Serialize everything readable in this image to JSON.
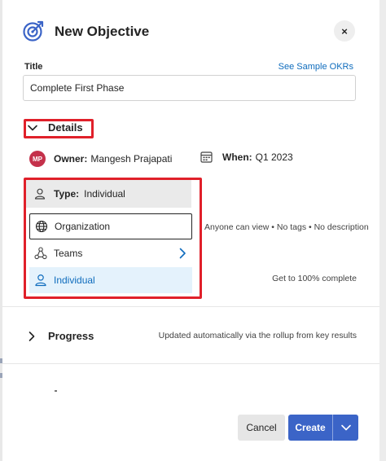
{
  "dialog": {
    "title": "New Objective",
    "close_label": "×",
    "close_icon": "close-icon",
    "header_icon": "objective-target-icon"
  },
  "title_field": {
    "label": "Title",
    "value": "Complete First Phase",
    "sample_link": "See Sample OKRs"
  },
  "details": {
    "label": "Details",
    "owner_label": "Owner:",
    "owner_value": "Mangesh Prajapati",
    "owner_initials": "MP",
    "when_label": "When:",
    "when_value": "Q1 2023",
    "type_label": "Type:",
    "type_value": "Individual"
  },
  "type_menu": {
    "items": [
      {
        "label": "Organization",
        "icon": "globe-icon"
      },
      {
        "label": "Teams",
        "icon": "teams-icon"
      },
      {
        "label": "Individual",
        "icon": "person-icon"
      }
    ]
  },
  "hints": {
    "visibility": "Anyone can view • No tags • No description",
    "complete": "Get to 100% complete",
    "progress": "Updated automatically via the rollup from key results"
  },
  "progress": {
    "label": "Progress"
  },
  "footer": {
    "cancel_label": "Cancel",
    "create_label": "Create"
  },
  "colors": {
    "accent": "#3b64c7",
    "link": "#0f6cbd",
    "highlight_border": "#e0202a",
    "avatar": "#c4314b",
    "selected_bg": "#e4f2fc"
  }
}
